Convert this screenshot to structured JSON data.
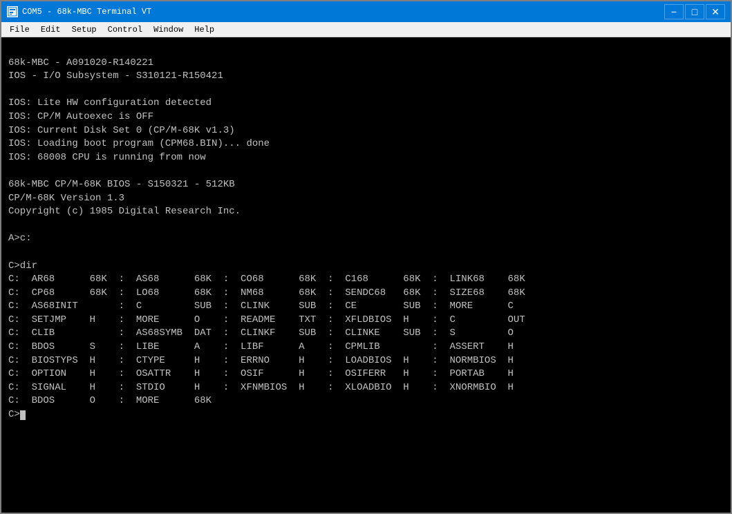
{
  "window": {
    "title": "COM5 - 68k-MBC Terminal VT",
    "icon": "■"
  },
  "title_buttons": {
    "minimize": "−",
    "maximize": "□",
    "close": "✕"
  },
  "menu": {
    "items": [
      "File",
      "Edit",
      "Setup",
      "Control",
      "Window",
      "Help"
    ]
  },
  "terminal": {
    "lines": [
      "",
      "68k-MBC - A091020-R140221",
      "IOS - I/O Subsystem - S310121-R150421",
      "",
      "IOS: Lite HW configuration detected",
      "IOS: CP/M Autoexec is OFF",
      "IOS: Current Disk Set 0 (CP/M-68K v1.3)",
      "IOS: Loading boot program (CPM68.BIN)... done",
      "IOS: 68008 CPU is running from now",
      "",
      "68k-MBC CP/M-68K BIOS - S150321 - 512KB",
      "CP/M-68K Version 1.3",
      "Copyright (c) 1985 Digital Research Inc.",
      "",
      "A>c:",
      "",
      "C>dir",
      "C:  AR68      68K  :  AS68      68K  :  CO68      68K  :  C168      68K  :  LINK68    68K",
      "C:  CP68      68K  :  LO68      68K  :  NM68      68K  :  SENDC68   68K  :  SIZE68    68K",
      "C:  AS68INIT       :  C         SUB  :  CLINK     SUB  :  CE        SUB  :  MORE      C",
      "C:  SETJMP    H    :  MORE      O    :  README    TXT  :  XFLDBIOS  H    :  C         OUT",
      "C:  CLIB           :  AS68SYMB  DAT  :  CLINKF    SUB  :  CLINKE    SUB  :  S         O",
      "C:  BDOS      S    :  LIBE      A    :  LIBF      A    :  CPMLIB         :  ASSERT    H",
      "C:  BIOSTYPS  H    :  CTYPE     H    :  ERRNO     H    :  LOADBIOS  H    :  NORMBIOS  H",
      "C:  OPTION    H    :  OSATTR    H    :  OSIF      H    :  OSIFERR   H    :  PORTAB    H",
      "C:  SIGNAL    H    :  STDIO     H    :  XFNMBIOS  H    :  XLOADBIO  H    :  XNORMBIO  H",
      "C:  BDOS      O    :  MORE      68K",
      "C>"
    ],
    "cursor_line_index": 30,
    "has_cursor": true
  }
}
